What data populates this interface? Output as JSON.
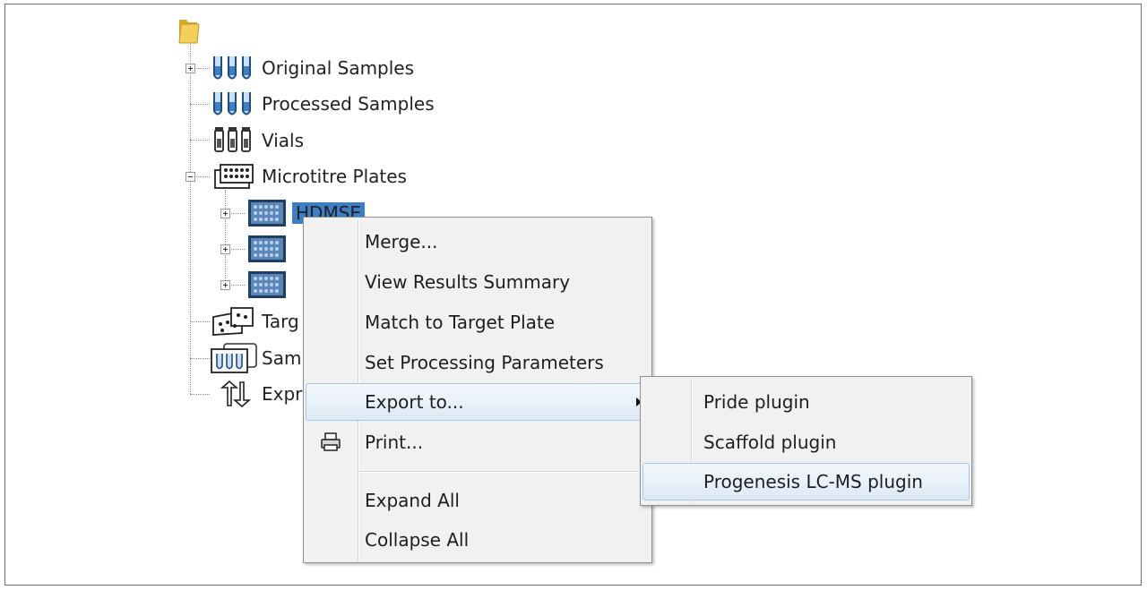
{
  "tree": {
    "original_samples": "Original Samples",
    "processed_samples": "Processed Samples",
    "vials": "Vials",
    "microtitre_plates": "Microtitre Plates",
    "plate_hdmse": "HDMSE",
    "target_partial": "Targ",
    "samp_partial": "Samp",
    "expr_partial": "Expr"
  },
  "context_menu": {
    "merge": "Merge...",
    "view_results_summary": "View Results Summary",
    "match_to_target_plate": "Match to Target Plate",
    "set_processing_parameters": "Set Processing Parameters",
    "export_to": "Export to...",
    "print": "Print...",
    "expand_all": "Expand All",
    "collapse_all": "Collapse All"
  },
  "submenu": {
    "pride_plugin": "Pride plugin",
    "scaffold_plugin": "Scaffold plugin",
    "progenesis_plugin": "Progenesis LC-MS plugin"
  },
  "colors": {
    "selection": "#3d7ec4",
    "menu_bg": "#f1f1f1",
    "hover_border": "#a8c6e8"
  }
}
